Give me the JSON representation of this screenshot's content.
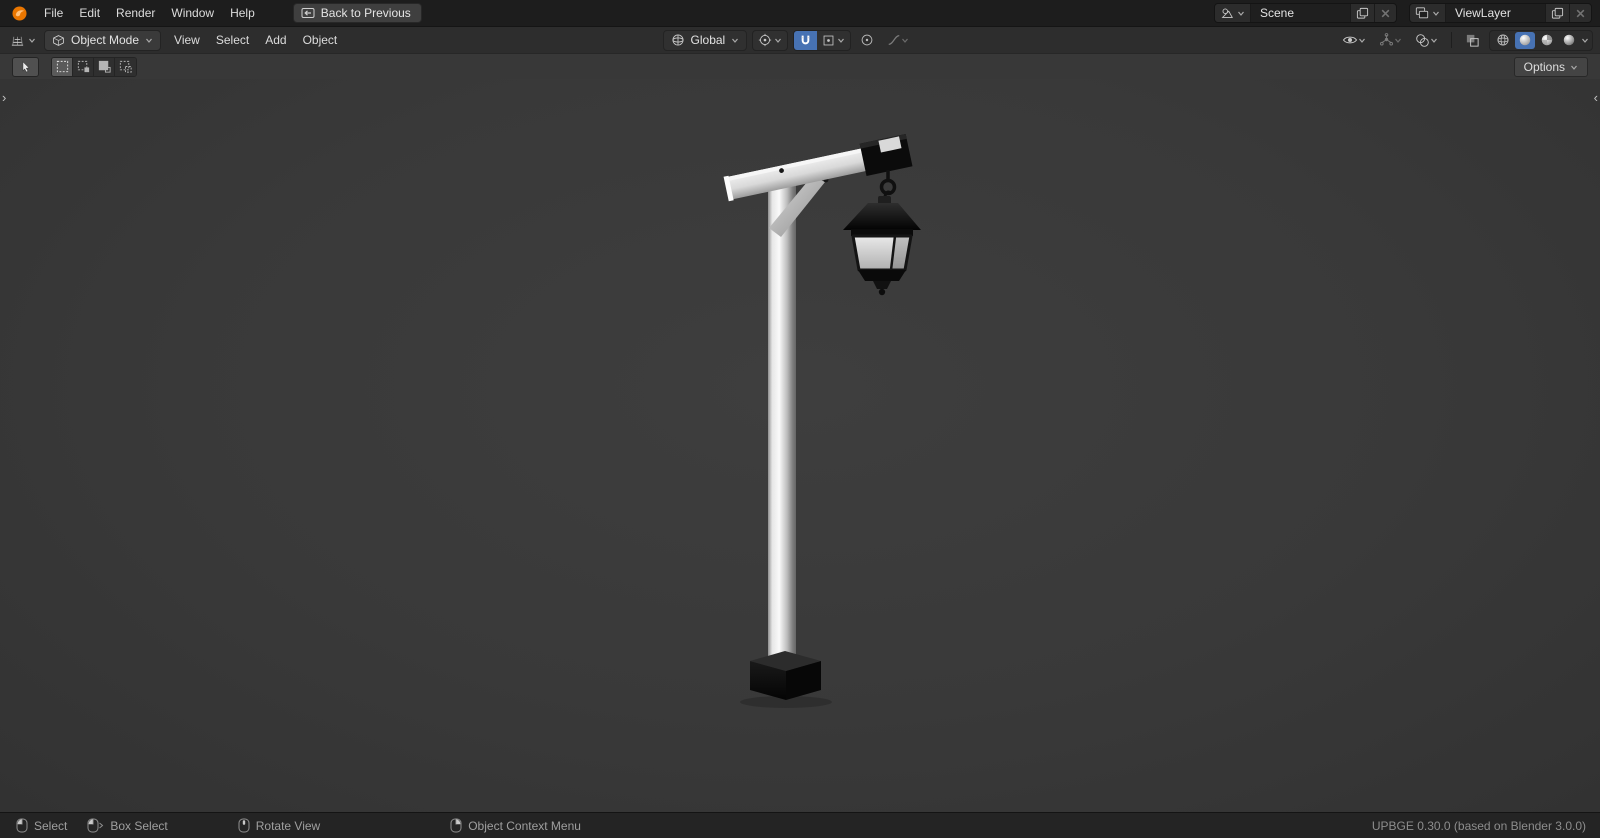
{
  "topbar": {
    "menus": [
      "File",
      "Edit",
      "Render",
      "Window",
      "Help"
    ],
    "back_label": "Back to Previous",
    "scene_value": "Scene",
    "viewlayer_value": "ViewLayer"
  },
  "header": {
    "mode_label": "Object Mode",
    "menus": [
      "View",
      "Select",
      "Add",
      "Object"
    ],
    "orientation_label": "Global"
  },
  "toolbar": {
    "options_label": "Options"
  },
  "viewport": {
    "left_expand_arrow": "›",
    "right_expand_arrow": "‹",
    "model_description": "white lamp post with black base and hanging black lantern"
  },
  "statusbar": {
    "items": [
      {
        "icon": "mouse-left-click-icon",
        "label": "Select"
      },
      {
        "icon": "mouse-left-drag-icon",
        "label": "Box Select"
      },
      {
        "icon": "mouse-middle-click-icon",
        "label": "Rotate View"
      },
      {
        "icon": "mouse-right-click-icon",
        "label": "Object Context Menu"
      }
    ],
    "version": "UPBGE 0.30.0 (based on Blender 3.0.0)"
  },
  "colors": {
    "accent_blue": "#4772b3",
    "logo_orange": "#ea7600",
    "topbar_bg": "#1d1d1d",
    "header_bg": "#2d2d2d",
    "toolbar_bg": "#383838",
    "viewport_bg": "#3a3a3a",
    "statusbar_bg": "#242424"
  },
  "icons": [
    "upbge-logo-icon",
    "back-icon",
    "scene-icon",
    "viewlayer-icon",
    "duplicate-icon",
    "close-icon",
    "chevron-down-icon",
    "editor-type-icon",
    "object-mode-icon",
    "global-orientation-icon",
    "pivot-point-icon",
    "snap-magnet-icon",
    "snap-target-icon",
    "proportional-editing-icon",
    "falloff-curve-icon",
    "visibility-eye-icon",
    "gizmo-icon",
    "overlays-icon",
    "xray-icon",
    "wireframe-shading-icon",
    "solid-shading-icon",
    "material-shading-icon",
    "rendered-shading-icon",
    "tweak-tool-icon",
    "box-select-icon",
    "mouse-left-click-icon",
    "mouse-left-drag-icon",
    "mouse-middle-click-icon",
    "mouse-right-click-icon"
  ]
}
